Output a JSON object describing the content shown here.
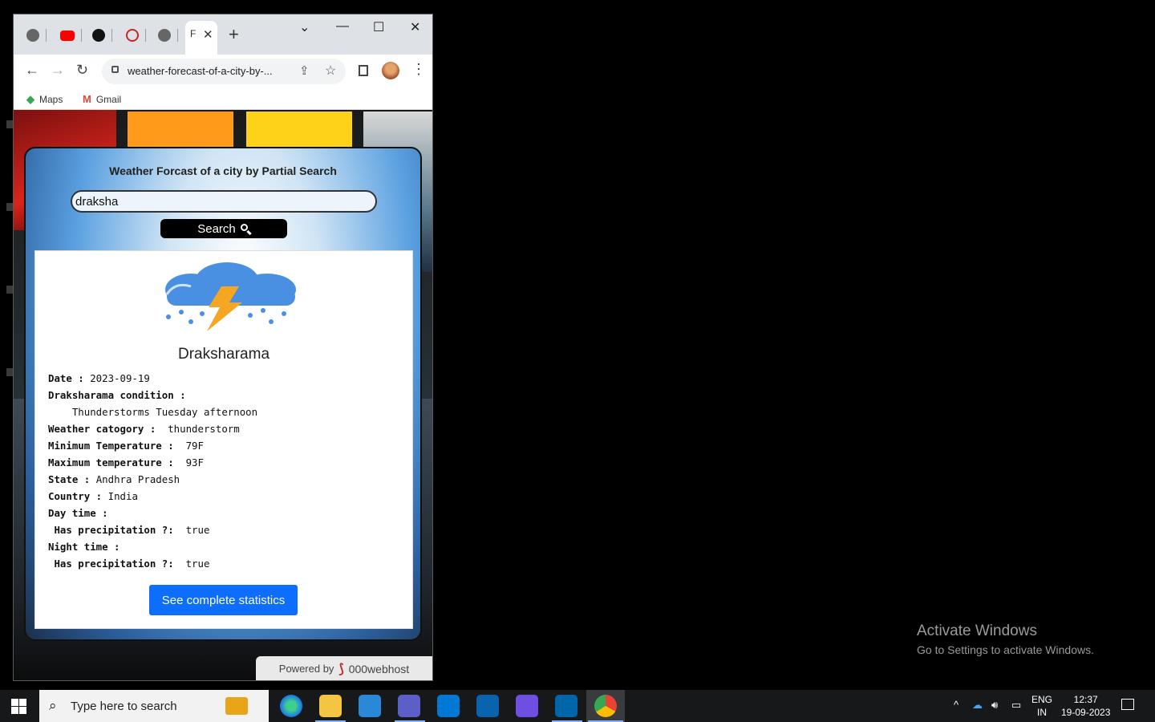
{
  "desktop": {
    "activate_title": "Activate Windows",
    "activate_sub": "Go to Settings to activate Windows."
  },
  "browser": {
    "active_tab_initial": "F",
    "new_tab": "+",
    "url": "weather-forecast-of-a-city-by-...",
    "bookmarks": [
      {
        "label": "Maps",
        "icon": "maps-icon"
      },
      {
        "label": "Gmail",
        "icon": "gmail-icon"
      }
    ]
  },
  "app": {
    "title": "Weather Forcast of a city by Partial Search",
    "search_value": "draksha",
    "search_button": "Search",
    "city": "Draksharama",
    "details": [
      {
        "key": "Date : ",
        "value": "2023-09-19"
      },
      {
        "key": "Draksharama condition :",
        "value": ""
      },
      {
        "key": "",
        "value": "    Thunderstorms Tuesday afternoon"
      },
      {
        "key": "Weather catogory : ",
        "value": " thunderstorm"
      },
      {
        "key": "Minimum Temperature : ",
        "value": " 79F"
      },
      {
        "key": "Maximum temperature : ",
        "value": " 93F"
      },
      {
        "key": "State : ",
        "value": "Andhra Pradesh"
      },
      {
        "key": "Country : ",
        "value": "India"
      },
      {
        "key": "Day time :",
        "value": ""
      },
      {
        "key": " Has precipitation ?: ",
        "value": " true"
      },
      {
        "key": "Night time :",
        "value": ""
      },
      {
        "key": " Has precipitation ?: ",
        "value": " true"
      }
    ],
    "stats_button": "See complete statistics",
    "powered_by": "Powered by",
    "host_brand": "000webhost"
  },
  "taskbar": {
    "search_placeholder": "Type here to search",
    "lang_top": "ENG",
    "lang_bottom": "IN",
    "time": "12:37",
    "date": "19-09-2023"
  },
  "colors": {
    "primary_button": "#0d6efd",
    "taskbar": "#17181a"
  }
}
